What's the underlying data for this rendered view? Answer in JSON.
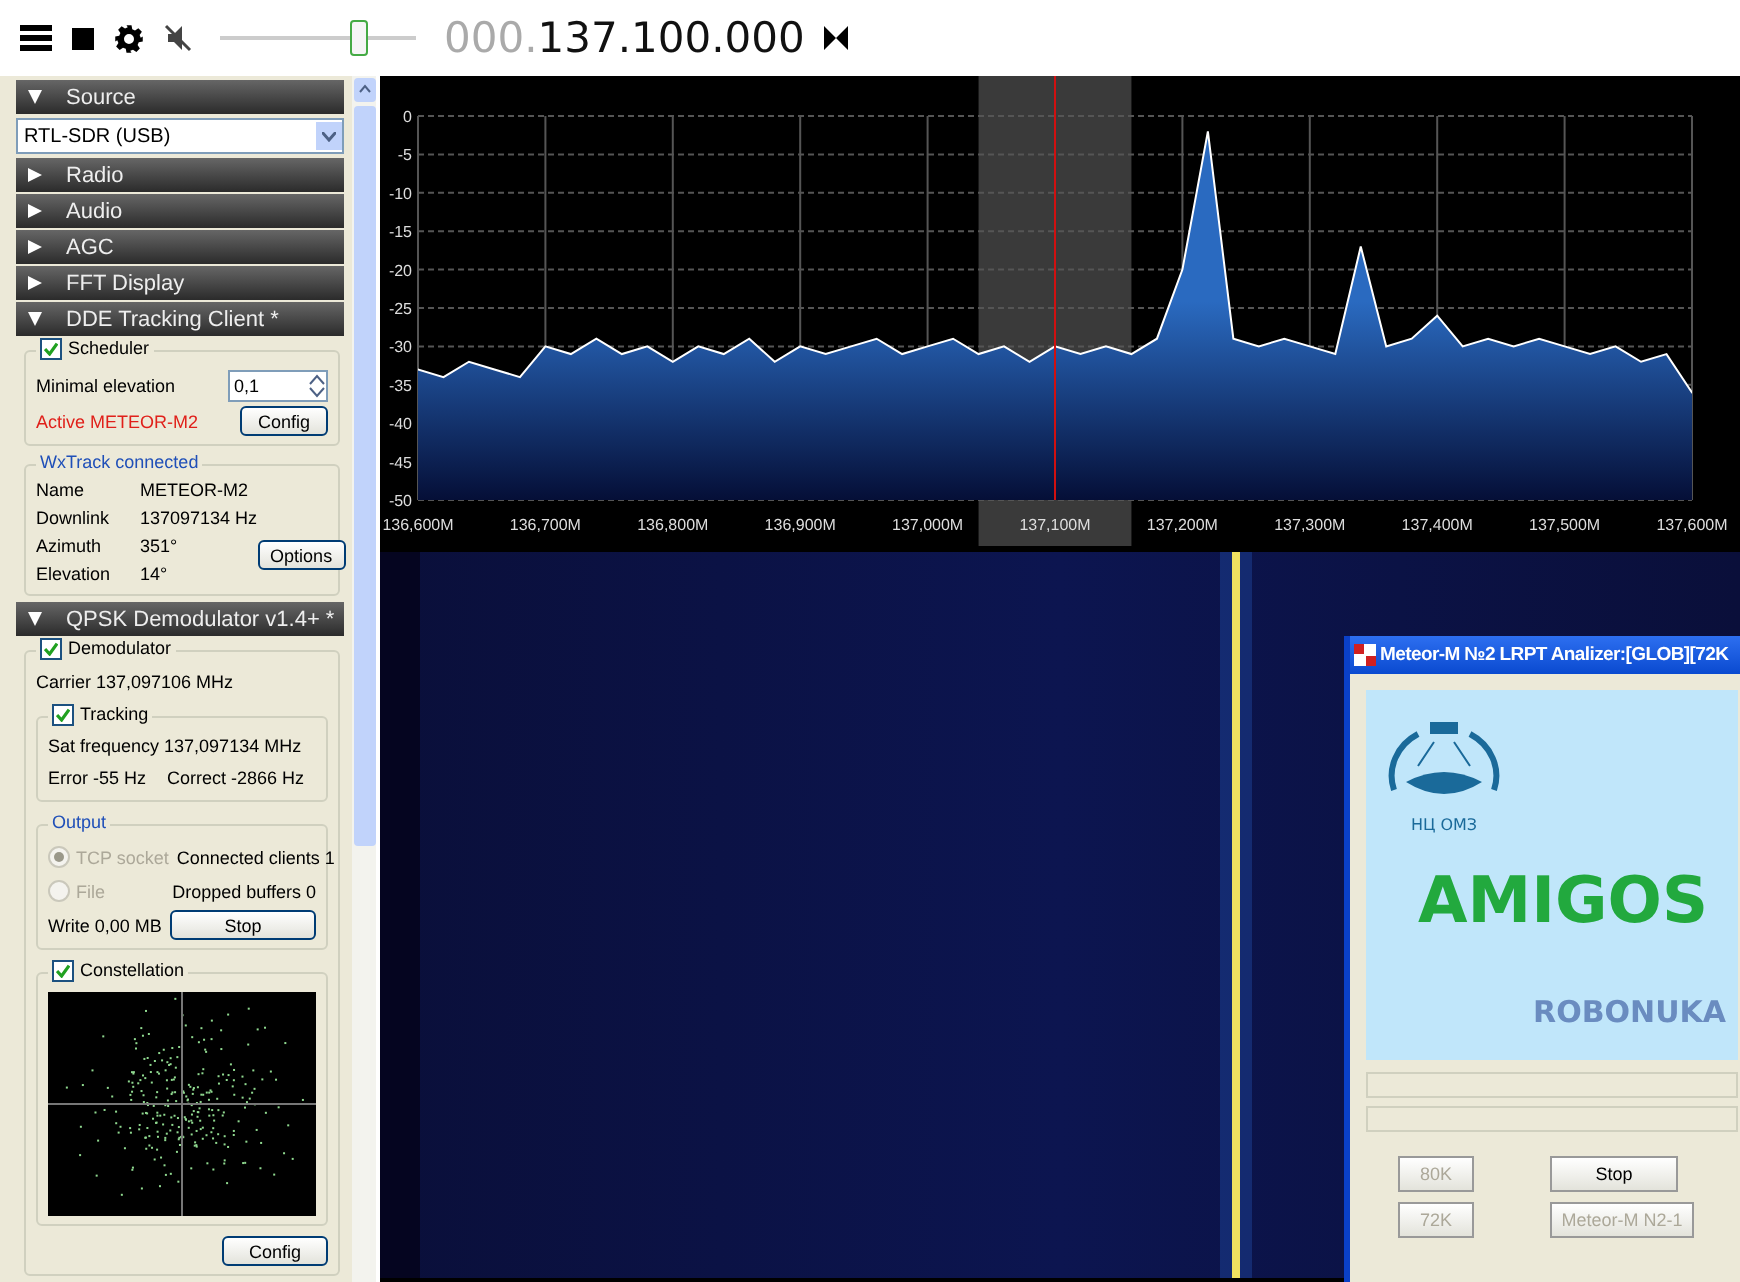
{
  "toolbar": {
    "frequency_prefix": "000.",
    "frequency": "137.100.000",
    "muted": true,
    "volume": {
      "level": 0.7
    }
  },
  "panels": [
    {
      "kind": "source",
      "title": "Source",
      "expanded": true,
      "device": "RTL-SDR (USB)"
    },
    {
      "kind": "plain",
      "title": "Radio",
      "expanded": false
    },
    {
      "kind": "plain",
      "title": "Audio",
      "expanded": false
    },
    {
      "kind": "plain",
      "title": "AGC",
      "expanded": false
    },
    {
      "kind": "plain",
      "title": "FFT Display",
      "expanded": false
    },
    {
      "kind": "dde",
      "title": "DDE Tracking Client *",
      "expanded": true,
      "scheduler": {
        "label": "Scheduler",
        "checked": true
      },
      "min_elevation": {
        "label": "Minimal elevation",
        "value": "0,1"
      },
      "status": "Active METEOR-M2",
      "config_button": "Config",
      "wxtrack": {
        "title": "WxTrack connected",
        "rows": [
          {
            "label": "Name",
            "value": "METEOR-M2"
          },
          {
            "label": "Downlink",
            "value": "137097134 Hz"
          },
          {
            "label": "Azimuth",
            "value": "351°"
          },
          {
            "label": "Elevation",
            "value": "14°"
          }
        ],
        "options_button": "Options"
      }
    },
    {
      "kind": "qpsk",
      "title": "QPSK Demodulator v1.4+ *",
      "expanded": true,
      "demodulator": {
        "label": "Demodulator",
        "checked": true
      },
      "carrier": "Carrier 137,097106 MHz",
      "tracking": {
        "label": "Tracking",
        "checked": true,
        "sat_frequency": "Sat frequency 137,097134 MHz",
        "error": "Error -55 Hz",
        "correct": "Correct -2866 Hz"
      },
      "output": {
        "title": "Output",
        "options": [
          {
            "label": "TCP socket",
            "selected": true,
            "disabled": true
          },
          {
            "label": "File",
            "selected": false,
            "disabled": true
          }
        ],
        "connected": "Connected clients 1",
        "dropped": "Dropped buffers 0",
        "write": "Write 0,00 MB",
        "stop_button": "Stop"
      },
      "constellation": {
        "label": "Constellation",
        "checked": true
      },
      "config_button": "Config"
    }
  ],
  "spectrum": {
    "chart_data": {
      "type": "area",
      "x": [
        136600,
        136620,
        136640,
        136660,
        136680,
        136700,
        136720,
        136740,
        136760,
        136780,
        136800,
        136820,
        136840,
        136860,
        136880,
        136900,
        136920,
        136940,
        136960,
        136980,
        137000,
        137020,
        137040,
        137060,
        137080,
        137100,
        137120,
        137140,
        137160,
        137180,
        137200,
        137220,
        137240,
        137260,
        137280,
        137300,
        137320,
        137340,
        137360,
        137380,
        137400,
        137420,
        137440,
        137460,
        137480,
        137500,
        137520,
        137540,
        137560,
        137580,
        137600
      ],
      "series": [
        {
          "color": "#ffffff",
          "values": [
            -33,
            -34,
            -32,
            -33,
            -34,
            -30,
            -31,
            -29,
            -31,
            -30,
            -32,
            -30,
            -31,
            -29,
            -32,
            -30,
            -31,
            -30,
            -29,
            -31,
            -30,
            -29,
            -31,
            -30,
            -32,
            -30,
            -31,
            -30,
            -31,
            -29,
            -20,
            -2,
            -29,
            -30,
            -29,
            -30,
            -31,
            -17,
            -30,
            -29,
            -26,
            -30,
            -29,
            -30,
            -29,
            -30,
            -31,
            -30,
            -32,
            -31,
            -36
          ]
        }
      ],
      "xlim": [
        136600,
        137600
      ],
      "ylim": [
        -50,
        0
      ],
      "grid": true,
      "bands": [
        {
          "axis": "x",
          "from": 137040,
          "to": 137160,
          "color": "#3a3a3a"
        }
      ],
      "ref_lines": [
        {
          "axis": "x",
          "value": 137100,
          "color": "#d01010"
        }
      ],
      "xticks": [
        {
          "value": 136600,
          "label": "136,600M"
        },
        {
          "value": 136700,
          "label": "136,700M"
        },
        {
          "value": 136800,
          "label": "136,800M"
        },
        {
          "value": 136900,
          "label": "136,900M"
        },
        {
          "value": 137000,
          "label": "137,000M"
        },
        {
          "value": 137100,
          "label": "137,100M"
        },
        {
          "value": 137200,
          "label": "137,200M"
        },
        {
          "value": 137300,
          "label": "137,300M"
        },
        {
          "value": 137400,
          "label": "137,400M"
        },
        {
          "value": 137500,
          "label": "137,500M"
        },
        {
          "value": 137600,
          "label": "137,600M"
        }
      ],
      "yticks": [
        0,
        -5,
        -10,
        -15,
        -20,
        -25,
        -30,
        -35,
        -40,
        -45,
        -50
      ]
    }
  },
  "analyzer_window": {
    "title": "Meteor-M №2 LRPT Analizer:[GLOB][72K",
    "logo_caption": "НЦ ОМЗ",
    "title_text": "AMIGOS",
    "subtitle": "ROBONUKA",
    "progress_bars": [
      {
        "level": 0
      },
      {
        "level": 0
      }
    ],
    "buttons": [
      {
        "label": "80K",
        "disabled": true
      },
      {
        "label": "Stop",
        "disabled": false
      },
      {
        "label": "72K",
        "disabled": true
      },
      {
        "label": "Meteor-M N2-1",
        "disabled": true
      }
    ]
  }
}
